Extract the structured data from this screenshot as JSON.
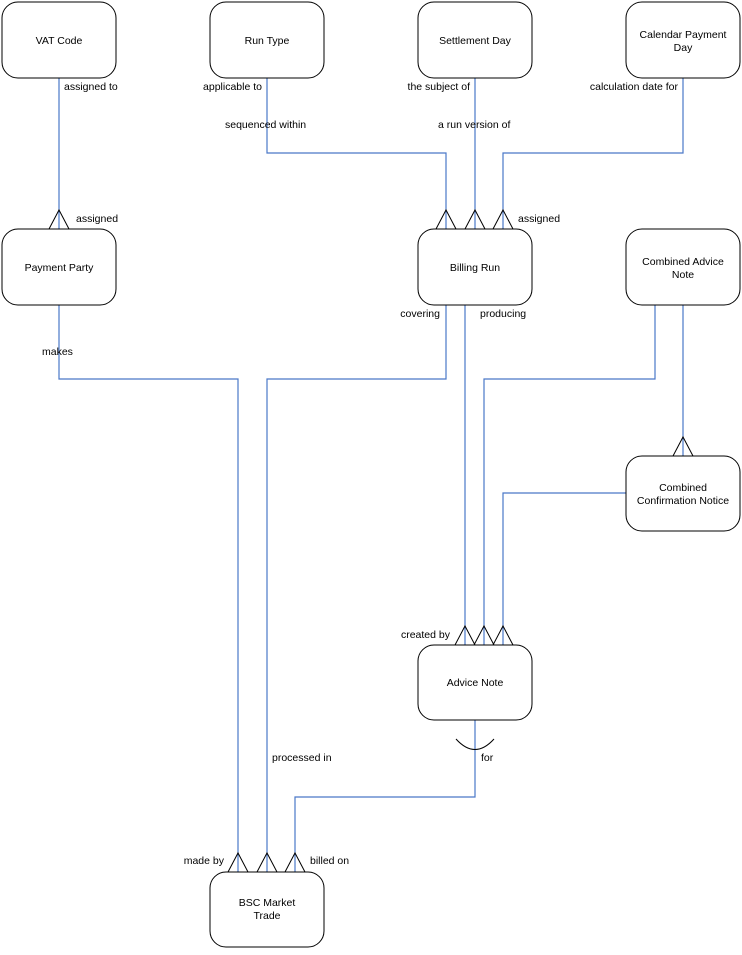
{
  "colors": {
    "relationship_line": "#4a78c8",
    "entity_border": "#000000"
  },
  "entities": {
    "vat_code": {
      "label": [
        "VAT Code"
      ]
    },
    "run_type": {
      "label": [
        "Run Type"
      ]
    },
    "settlement_day": {
      "label": [
        "Settlement Day"
      ]
    },
    "calendar_payment_day": {
      "label": [
        "Calendar Payment",
        "Day"
      ]
    },
    "payment_party": {
      "label": [
        "Payment Party"
      ]
    },
    "billing_run": {
      "label": [
        "Billing Run"
      ]
    },
    "combined_advice_note": {
      "label": [
        "Combined Advice",
        "Note"
      ]
    },
    "combined_confirmation_notice": {
      "label": [
        "Combined",
        "Confirmation Notice"
      ]
    },
    "advice_note": {
      "label": [
        "Advice Note"
      ]
    },
    "bsc_market_trade": {
      "label": [
        "BSC Market",
        "Trade"
      ]
    }
  },
  "relationship_labels": {
    "assigned_to": "assigned to",
    "assigned_pp": "assigned",
    "applicable_to": "applicable to",
    "sequenced_within": "sequenced within",
    "the_subject_of": "the subject of",
    "a_run_version_of": "a run version of",
    "calculation_date_for": "calculation date for",
    "assigned_br": "assigned",
    "makes": "makes",
    "covering": "covering",
    "producing": "producing",
    "created_by": "created by",
    "processed_in": "processed in",
    "for": "for",
    "made_by": "made by",
    "billed_on": "billed on"
  }
}
